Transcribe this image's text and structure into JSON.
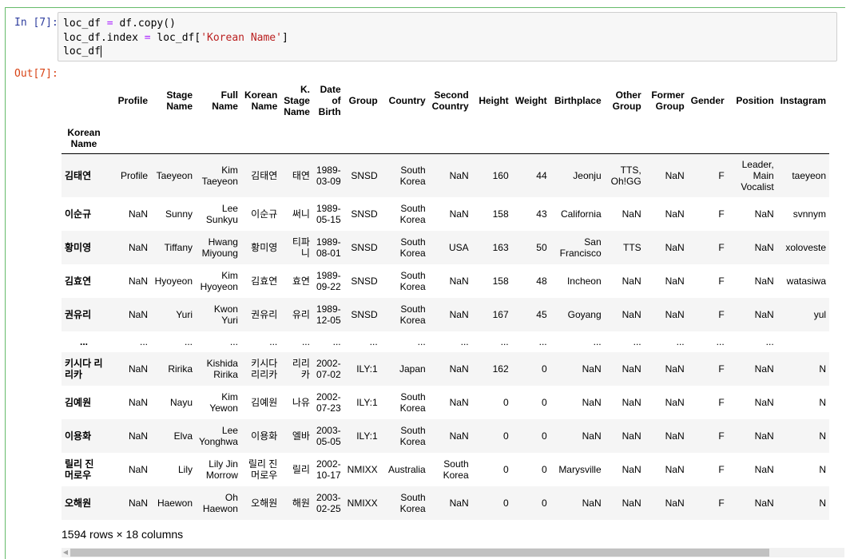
{
  "cell": {
    "in_prompt": "In [7]:",
    "out_prompt": "Out[7]:",
    "code": [
      [
        {
          "t": "loc_df "
        },
        {
          "t": "=",
          "c": "op"
        },
        {
          "t": " df.copy()"
        }
      ],
      [
        {
          "t": "loc_df.index "
        },
        {
          "t": "=",
          "c": "op"
        },
        {
          "t": " loc_df["
        },
        {
          "t": "'Korean Name'",
          "c": "str"
        },
        {
          "t": "]"
        }
      ],
      [
        {
          "t": "loc_df"
        }
      ]
    ]
  },
  "table": {
    "index_name": "Korean Name",
    "columns": [
      "Profile",
      "Stage Name",
      "Full Name",
      "Korean Name",
      "K. Stage Name",
      "Date of Birth",
      "Group",
      "Country",
      "Second Country",
      "Height",
      "Weight",
      "Birthplace",
      "Other Group",
      "Former Group",
      "Gender",
      "Position",
      "Instagram"
    ],
    "rows": [
      {
        "index": "김태연",
        "cells": [
          "Profile",
          "Taeyeon",
          "Kim Taeyeon",
          "김태연",
          "태연",
          "1989-03-09",
          "SNSD",
          "South Korea",
          "NaN",
          "160",
          "44",
          "Jeonju",
          "TTS, Oh!GG",
          "NaN",
          "F",
          "Leader, Main Vocalist",
          "taeyeon"
        ]
      },
      {
        "index": "이순규",
        "cells": [
          "NaN",
          "Sunny",
          "Lee Sunkyu",
          "이순규",
          "써니",
          "1989-05-15",
          "SNSD",
          "South Korea",
          "NaN",
          "158",
          "43",
          "California",
          "NaN",
          "NaN",
          "F",
          "NaN",
          "svnnym"
        ]
      },
      {
        "index": "황미영",
        "cells": [
          "NaN",
          "Tiffany",
          "Hwang Miyoung",
          "황미영",
          "티파니",
          "1989-08-01",
          "SNSD",
          "South Korea",
          "USA",
          "163",
          "50",
          "San Francisco",
          "TTS",
          "NaN",
          "F",
          "NaN",
          "xoloveste"
        ]
      },
      {
        "index": "김효연",
        "cells": [
          "NaN",
          "Hyoyeon",
          "Kim Hyoyeon",
          "김효연",
          "효연",
          "1989-09-22",
          "SNSD",
          "South Korea",
          "NaN",
          "158",
          "48",
          "Incheon",
          "NaN",
          "NaN",
          "F",
          "NaN",
          "watasiwa"
        ]
      },
      {
        "index": "권유리",
        "cells": [
          "NaN",
          "Yuri",
          "Kwon Yuri",
          "권유리",
          "유리",
          "1989-12-05",
          "SNSD",
          "South Korea",
          "NaN",
          "167",
          "45",
          "Goyang",
          "NaN",
          "NaN",
          "F",
          "NaN",
          "yul"
        ]
      },
      {
        "index": "...",
        "cells": [
          "...",
          "...",
          "...",
          "...",
          "...",
          "...",
          "...",
          "...",
          "...",
          "...",
          "...",
          "...",
          "...",
          "...",
          "...",
          "...",
          ""
        ]
      },
      {
        "index": "키시다 리리카",
        "cells": [
          "NaN",
          "Ririka",
          "Kishida Ririka",
          "키시다 리리카",
          "리리카",
          "2002-07-02",
          "ILY:1",
          "Japan",
          "NaN",
          "162",
          "0",
          "NaN",
          "NaN",
          "NaN",
          "F",
          "NaN",
          "N"
        ]
      },
      {
        "index": "김예원",
        "cells": [
          "NaN",
          "Nayu",
          "Kim Yewon",
          "김예원",
          "나유",
          "2002-07-23",
          "ILY:1",
          "South Korea",
          "NaN",
          "0",
          "0",
          "NaN",
          "NaN",
          "NaN",
          "F",
          "NaN",
          "N"
        ]
      },
      {
        "index": "이용화",
        "cells": [
          "NaN",
          "Elva",
          "Lee Yonghwa",
          "이용화",
          "엘바",
          "2003-05-05",
          "ILY:1",
          "South Korea",
          "NaN",
          "0",
          "0",
          "NaN",
          "NaN",
          "NaN",
          "F",
          "NaN",
          "N"
        ]
      },
      {
        "index": "릴리 진 머로우",
        "cells": [
          "NaN",
          "Lily",
          "Lily Jin Morrow",
          "릴리 진 머로우",
          "릴리",
          "2002-10-17",
          "NMIXX",
          "Australia",
          "South Korea",
          "0",
          "0",
          "Marysville",
          "NaN",
          "NaN",
          "F",
          "NaN",
          "N"
        ]
      },
      {
        "index": "오해원",
        "cells": [
          "NaN",
          "Haewon",
          "Oh Haewon",
          "오해원",
          "해원",
          "2003-02-25",
          "NMIXX",
          "South Korea",
          "NaN",
          "0",
          "0",
          "NaN",
          "NaN",
          "NaN",
          "F",
          "NaN",
          "N"
        ]
      }
    ],
    "shape_text": "1594 rows × 18 columns"
  }
}
